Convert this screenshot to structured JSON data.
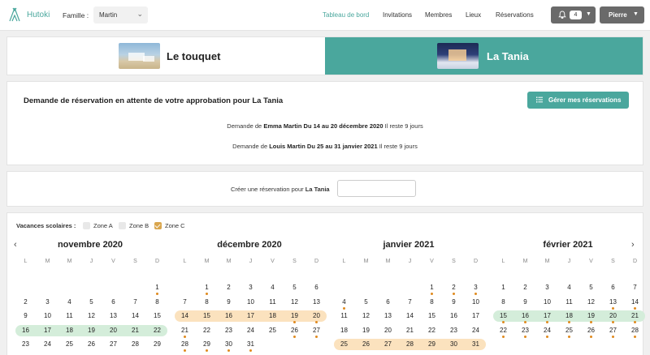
{
  "nav": {
    "brand": "Hutoki",
    "family_label": "Famille :",
    "family_value": "Martin",
    "links": [
      {
        "label": "Tableau de bord",
        "active": true
      },
      {
        "label": "Invitations",
        "active": false
      },
      {
        "label": "Membres",
        "active": false
      },
      {
        "label": "Lieux",
        "active": false
      },
      {
        "label": "Réservations",
        "active": false
      }
    ],
    "notif_count": "4",
    "user": "Pierre"
  },
  "places": [
    {
      "name": "Le touquet",
      "selected": false
    },
    {
      "name": "La Tania",
      "selected": true
    }
  ],
  "pending": {
    "title": "Demande de réservation en attente de votre approbation pour La Tania",
    "manage_button": "Gérer mes réservations",
    "requests": [
      {
        "prefix": "Demande de",
        "who": "Emma Martin",
        "dates": "Du 14 au 20 décembre 2020",
        "suffix": "Il reste 9 jours"
      },
      {
        "prefix": "Demande de",
        "who": "Louis Martin",
        "dates": "Du 25 au 31 janvier 2021",
        "suffix": "Il reste 9 jours"
      }
    ]
  },
  "create": {
    "label": "Créer une réservation pour",
    "place": "La Tania",
    "input_value": ""
  },
  "calendar": {
    "vacances_label": "Vacances scolaires :",
    "zones": [
      {
        "label": "Zone A",
        "checked": false
      },
      {
        "label": "Zone B",
        "checked": false
      },
      {
        "label": "Zone C",
        "checked": true
      }
    ],
    "prev_arrow": "‹",
    "next_arrow": "›",
    "weekdays": [
      "L",
      "M",
      "M",
      "J",
      "V",
      "S",
      "D"
    ],
    "months": [
      {
        "title": "novembre 2020",
        "first_col": 6,
        "days": 30,
        "dots": [
          1
        ],
        "green": [
          [
            16,
            22
          ]
        ],
        "orange": []
      },
      {
        "title": "décembre 2020",
        "first_col": 1,
        "days": 31,
        "dots": [
          1,
          19,
          20,
          21,
          26,
          27,
          28,
          29,
          30,
          31
        ],
        "green": [],
        "orange": [
          [
            14,
            20
          ]
        ]
      },
      {
        "title": "janvier 2021",
        "first_col": 4,
        "days": 31,
        "dots": [
          1,
          2,
          3,
          4
        ],
        "green": [],
        "orange": [
          [
            25,
            31
          ]
        ]
      },
      {
        "title": "février 2021",
        "first_col": 0,
        "days": 28,
        "dots": [
          13,
          14,
          15,
          16,
          17,
          18,
          19,
          20,
          21,
          22,
          23,
          24,
          25,
          26,
          27,
          28
        ],
        "green": [
          [
            15,
            21
          ]
        ],
        "orange": []
      }
    ]
  }
}
